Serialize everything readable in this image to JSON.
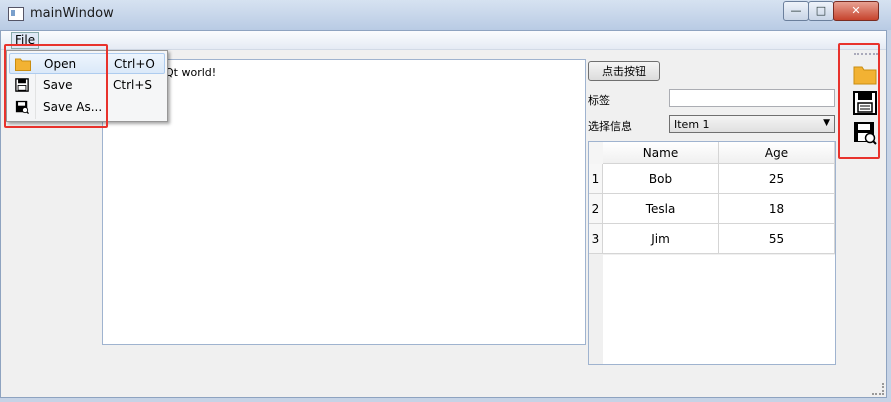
{
  "window": {
    "title": "mainWindow"
  },
  "menu": {
    "file_label": "File"
  },
  "file_menu": {
    "items": [
      {
        "label": "Open",
        "shortcut": "Ctrl+O",
        "icon": "folder-icon"
      },
      {
        "label": "Save",
        "shortcut": "Ctrl+S",
        "icon": "save-icon"
      },
      {
        "label": "Save As...",
        "shortcut": "",
        "icon": "save-as-icon"
      }
    ]
  },
  "central": {
    "text": "Qt world!"
  },
  "panel": {
    "button_label": "点击按钮",
    "tag_label": "标签",
    "tag_value": "",
    "select_label": "选择信息",
    "select_value": "Item 1"
  },
  "table": {
    "headers": [
      "Name",
      "Age"
    ],
    "rows": [
      {
        "index": "1",
        "name": "Bob",
        "age": "25"
      },
      {
        "index": "2",
        "name": "Tesla",
        "age": "18"
      },
      {
        "index": "3",
        "name": "Jim",
        "age": "55"
      }
    ]
  },
  "toolbar": {
    "icons": [
      "folder-icon",
      "save-icon",
      "save-as-icon"
    ]
  },
  "colors": {
    "highlight": "#e8322c",
    "folder": "#f2b233"
  }
}
